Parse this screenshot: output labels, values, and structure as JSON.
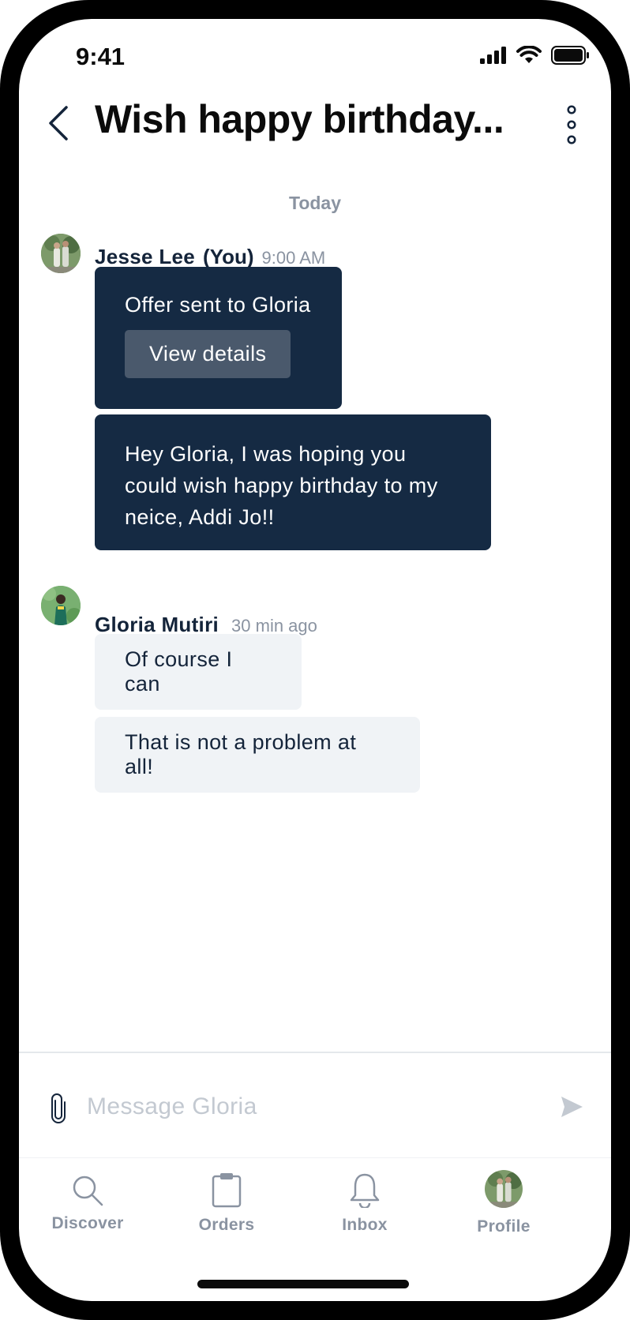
{
  "status_bar": {
    "time": "9:41"
  },
  "header": {
    "title": "Wish happy birthday..."
  },
  "conversation": {
    "date_separator": "Today",
    "groups": [
      {
        "sender": "Jesse Lee",
        "sender_tag": "(You)",
        "time": "9:00 AM",
        "offer_text": "Offer sent to Gloria",
        "offer_button": "View details",
        "messages": [
          "Hey Gloria, I was hoping you could wish happy birthday to my neice, Addi Jo!!"
        ]
      },
      {
        "sender": "Gloria Mutiri",
        "time": "30 min ago",
        "messages": [
          "Of course I can",
          "That is not a problem at all!"
        ]
      }
    ]
  },
  "composer": {
    "placeholder": "Message Gloria"
  },
  "tabs": [
    {
      "label": "Discover",
      "icon": "search-icon"
    },
    {
      "label": "Orders",
      "icon": "clipboard-icon"
    },
    {
      "label": "Inbox",
      "icon": "bell-icon"
    },
    {
      "label": "Profile",
      "icon": "avatar"
    }
  ],
  "colors": {
    "dark_bubble": "#152a43",
    "light_bubble": "#f0f3f6",
    "muted_text": "#8a93a1",
    "button": "#4a596c"
  }
}
